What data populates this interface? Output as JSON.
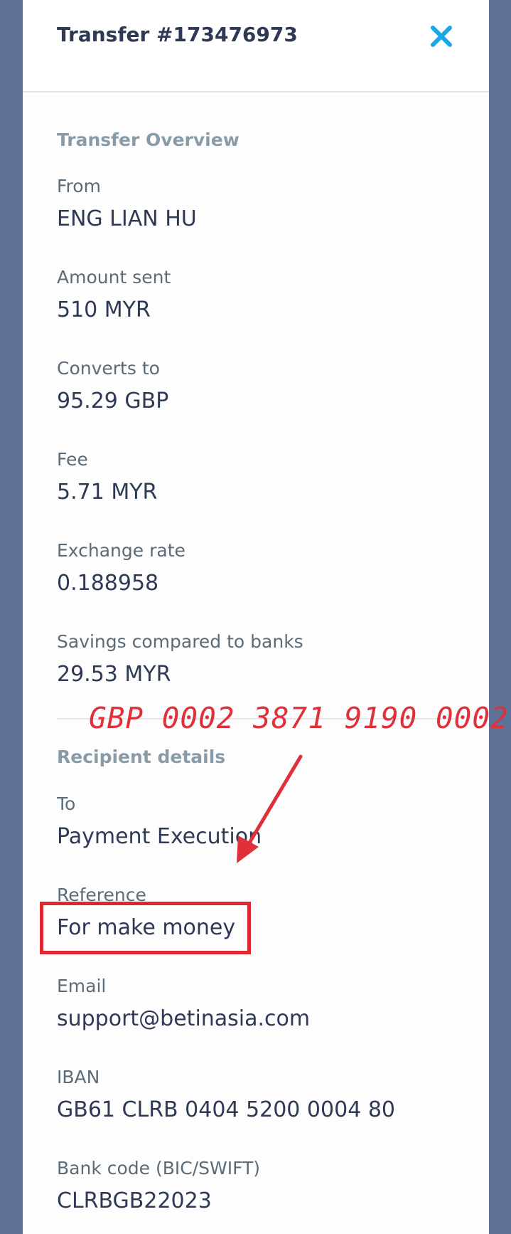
{
  "header": {
    "title": "Transfer #173476973",
    "close_icon": "close-icon"
  },
  "overview": {
    "section_title": "Transfer Overview",
    "items": [
      {
        "label": "From",
        "value": "ENG LIAN HU"
      },
      {
        "label": "Amount sent",
        "value": "510 MYR"
      },
      {
        "label": "Converts to",
        "value": "95.29 GBP"
      },
      {
        "label": "Fee",
        "value": "5.71 MYR"
      },
      {
        "label": "Exchange rate",
        "value": "0.188958"
      },
      {
        "label": "Savings compared to banks",
        "value": "29.53 MYR"
      }
    ]
  },
  "recipient": {
    "section_title": "Recipient details",
    "items": [
      {
        "label": "To",
        "value": "Payment Execution"
      },
      {
        "label": "Reference",
        "value": "For make money"
      },
      {
        "label": "Email",
        "value": "support@betinasia.com"
      },
      {
        "label": "IBAN",
        "value": "GB61 CLRB 0404 5200 0004 80"
      },
      {
        "label": "Bank code (BIC/SWIFT)",
        "value": "CLRBGB22023"
      }
    ]
  },
  "annotation": {
    "handwritten_text": "GBP 0002 3871 9190 0002"
  },
  "colors": {
    "background": "#5e7297",
    "panel": "#fdfdfd",
    "title_text": "#2e3a55",
    "section_title": "#8a9ba8",
    "label_text": "#5b6b78",
    "close_icon": "#1aa7e8",
    "annotation_red": "#e0303a"
  }
}
